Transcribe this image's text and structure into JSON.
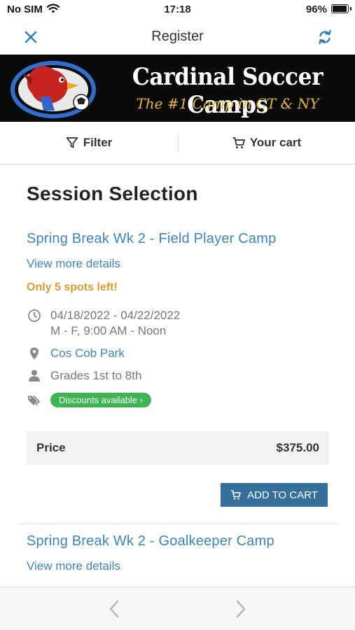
{
  "status_bar": {
    "carrier": "No SIM",
    "time": "17:18",
    "battery": "96%",
    "battery_level": 0.96
  },
  "nav": {
    "title": "Register",
    "close_icon": "close-icon",
    "refresh_icon": "refresh-icon"
  },
  "banner": {
    "brand": "Cardinal Soccer Camps",
    "tagline": "The #1 Camp in CT & NY"
  },
  "tabs": [
    {
      "label": "Filter",
      "icon": "filter-icon"
    },
    {
      "label": "Your cart",
      "icon": "cart-icon"
    }
  ],
  "section_title": "Session Selection",
  "sessions": [
    {
      "title": "Spring Break Wk 2 - Field Player Camp",
      "details_link": "View more details",
      "spots": "Only 5 spots left!",
      "dates": "04/18/2022 - 04/22/2022",
      "schedule": "M - F, 9:00 AM - Noon",
      "location": "Cos Cob Park",
      "grades": "Grades 1st to 8th",
      "discount": "Discounts available ›",
      "price_label": "Price",
      "price": "$375.00",
      "add_to_cart": "ADD TO CART"
    },
    {
      "title": "Spring Break Wk 2 - Goalkeeper Camp",
      "details_link": "View more details"
    }
  ],
  "colors": {
    "link": "#3b84bd",
    "warning": "#e09a2a",
    "success": "#3db551",
    "button": "#356f9c"
  }
}
